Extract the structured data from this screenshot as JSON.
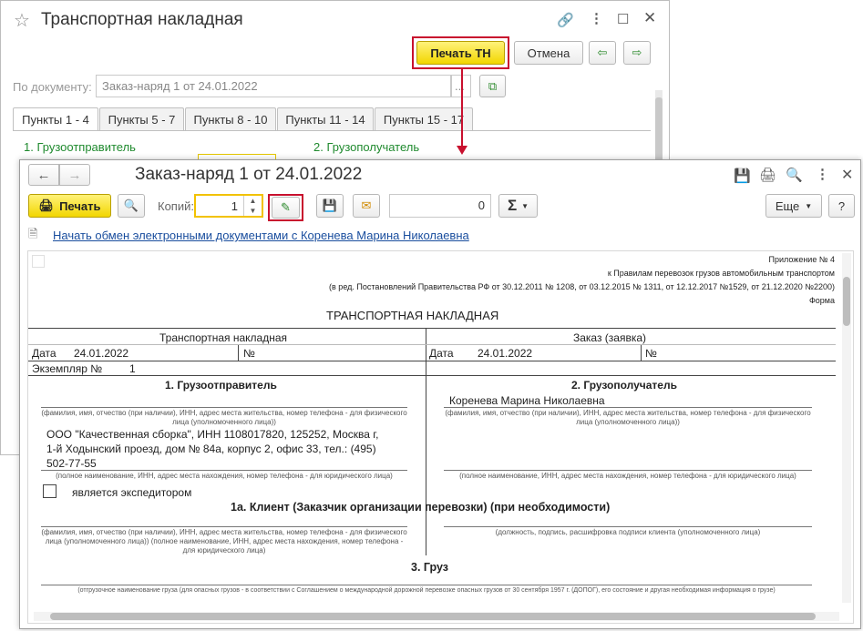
{
  "back_window": {
    "title": "Транспортная накладная",
    "print_button": "Печать ТН",
    "cancel_button": "Отмена",
    "doc_label": "По документу:",
    "doc_value": "Заказ-наряд 1 от 24.01.2022",
    "doc_dots": "...",
    "tabs": [
      "Пункты 1 - 4",
      "Пункты 5 - 7",
      "Пункты 8 - 10",
      "Пункты 11 - 14",
      "Пункты 15 - 17"
    ],
    "section1": "1. Грузоотправитель",
    "section2": "2. Грузополучатель"
  },
  "front_window": {
    "title": "Заказ-наряд 1 от 24.01.2022",
    "print_button": "Печать",
    "copies_label": "Копий:",
    "copies_value": "1",
    "sum_value": "0",
    "sigma": "Σ",
    "more_button": "Еще",
    "help_button": "?",
    "edi_link": "Начать обмен электронными документами с Коренева Марина Николаевна"
  },
  "document": {
    "appendix": "Приложение № 4",
    "rules": "к Правилам перевозок грузов автомобильным транспортом",
    "edition": "(в ред. Постановлений Правительства РФ от 30.12.2011 № 1208, от 03.12.2015 № 1311, от 12.12.2017 №1529, от 21.12.2020 №2200)",
    "form": "Форма",
    "main_title": "ТРАНСПОРТНАЯ НАКЛАДНАЯ",
    "left_header": "Транспортная накладная",
    "right_header": "Заказ (заявка)",
    "date_label": "Дата",
    "date_value": "24.01.2022",
    "number_label": "№",
    "copy_label": "Экземпляр №",
    "copy_value": "1",
    "shipper_title": "1. Грузоотправитель",
    "consignee_title": "2. Грузополучатель",
    "consignee_name": "Коренева Марина Николаевна",
    "person_hint": "(фамилия, имя, отчество (при наличии), ИНН, адрес места жительства, номер телефона - для физического лица (уполномоченного лица))",
    "shipper_line1": "ООО \"Качественная сборка\",  ИНН 1108017820, 125252, Москва г,",
    "shipper_line2": "1-й Ходынский проезд, дом № 84а, корпус 2, офис 33,  тел.: (495)",
    "shipper_line3": "502-77-55",
    "org_hint": "(полное наименование, ИНН, адрес места нахождения, номер телефона - для юридического лица)",
    "forwarder": "является экспедитором",
    "client_title": "1а. Клиент (Заказчик организации перевозки) (при необходимости)",
    "client_hint": "(фамилия, имя, отчество (при наличии), ИНН, адрес места жительства, номер телефона - для физического лица (уполномоченного лица)) (полное наименование, ИНН, адрес места нахождения, номер телефона - для юридического лица)",
    "signature_hint": "(должность, подпись, расшифровка подписи клиента (уполномоченного лица)",
    "cargo_title": "3. Груз",
    "cargo_hint": "(отгрузочное наименование груза (для опасных грузов - в соответствии с Соглашением о международной дорожной перевозке опасных грузов от 30 сентября 1957 г. (ДОПОГ), его состояние и другая необходимая информация о грузе)"
  }
}
